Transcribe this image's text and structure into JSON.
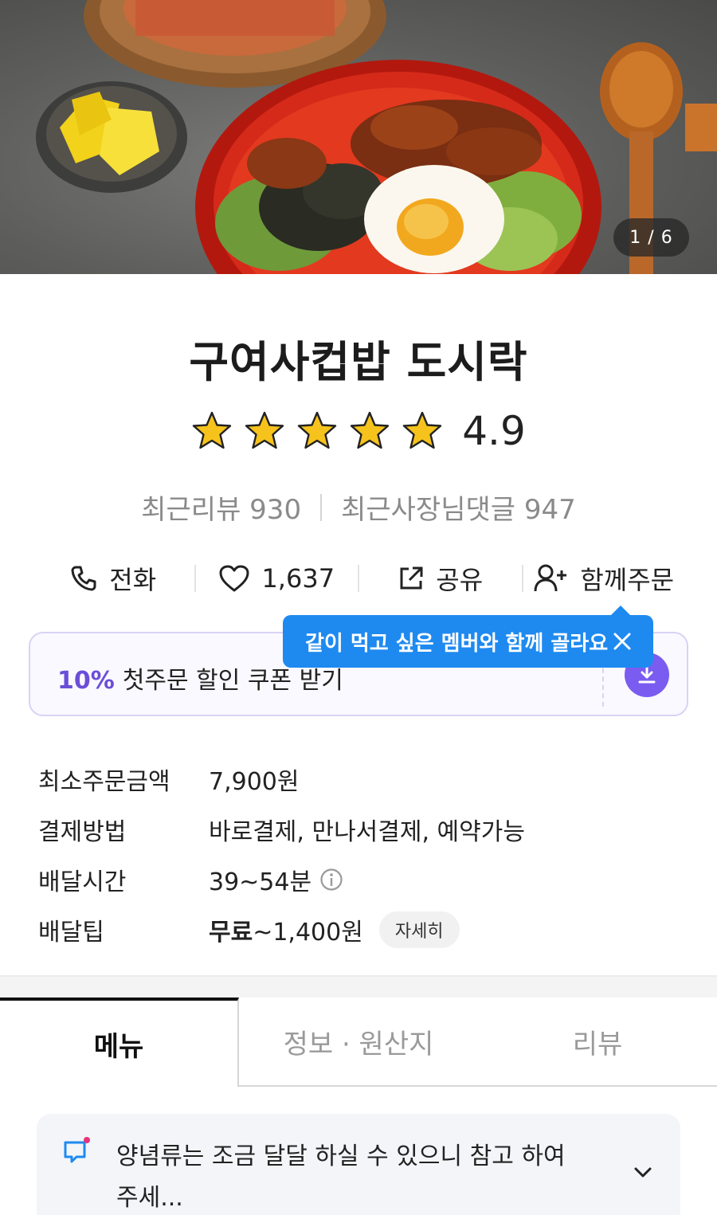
{
  "hero": {
    "pager": "1 / 6"
  },
  "store": {
    "name": "구여사컵밥 도시락",
    "rating": "4.9",
    "stars": 5,
    "recent_reviews": "최근리뷰 930",
    "recent_owner_comments": "최근사장님댓글 947"
  },
  "actions": {
    "call": "전화",
    "likes": "1,637",
    "share": "공유",
    "group_order": "함께주문"
  },
  "coupon": {
    "percent": "10%",
    "text": "첫주문 할인 쿠폰 받기"
  },
  "tooltip": {
    "text": "같이 먹고 싶은 멤버와 함께 골라요"
  },
  "info": {
    "min_order_label": "최소주문금액",
    "min_order_value": "7,900원",
    "payment_label": "결제방법",
    "payment_value": "바로결제, 만나서결제, 예약가능",
    "delivery_time_label": "배달시간",
    "delivery_time_value": "39~54분",
    "delivery_tip_label": "배달팁",
    "delivery_tip_free": "무료",
    "delivery_tip_value": "~1,400원",
    "detail_button": "자세히"
  },
  "tabs": [
    "메뉴",
    "정보 · 원산지",
    "리뷰"
  ],
  "notice": {
    "text": "양념류는 조금 달달 하실 수 있으니 참고 하여 주세..."
  },
  "colors": {
    "accent_purple": "#7a5cf0",
    "tooltip_blue": "#1e8af0",
    "star_gold": "#f6c31c"
  }
}
